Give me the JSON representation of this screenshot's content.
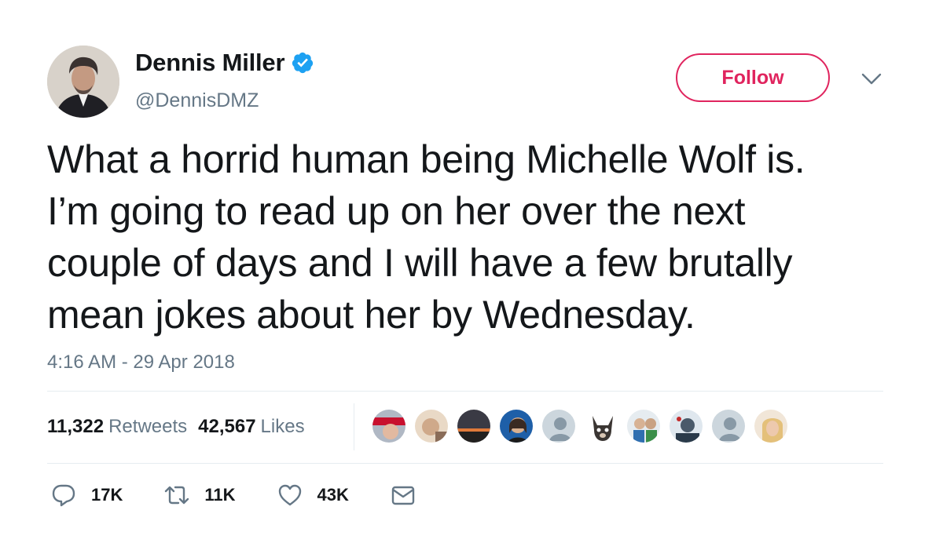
{
  "author": {
    "name": "Dennis Miller",
    "handle": "@DennisDMZ",
    "verified": true
  },
  "follow_button": {
    "label": "Follow"
  },
  "tweet": {
    "text_lines": [
      "What a horrid human being Michelle Wolf is.",
      "I’m going to read up on her over the next",
      "couple of days and I will have a few brutally",
      "mean jokes about her by Wednesday."
    ],
    "timestamp": "4:16 AM - 29 Apr 2018"
  },
  "stats": {
    "retweets_count": "11,322",
    "retweets_label": "Retweets",
    "likes_count": "42,567",
    "likes_label": "Likes"
  },
  "actions": {
    "reply_count": "17K",
    "retweet_count": "11K",
    "like_count": "43K"
  },
  "colors": {
    "accent": "#e0245e",
    "verified": "#1da1f2",
    "muted": "#657786",
    "divider": "#e6ecf0"
  }
}
